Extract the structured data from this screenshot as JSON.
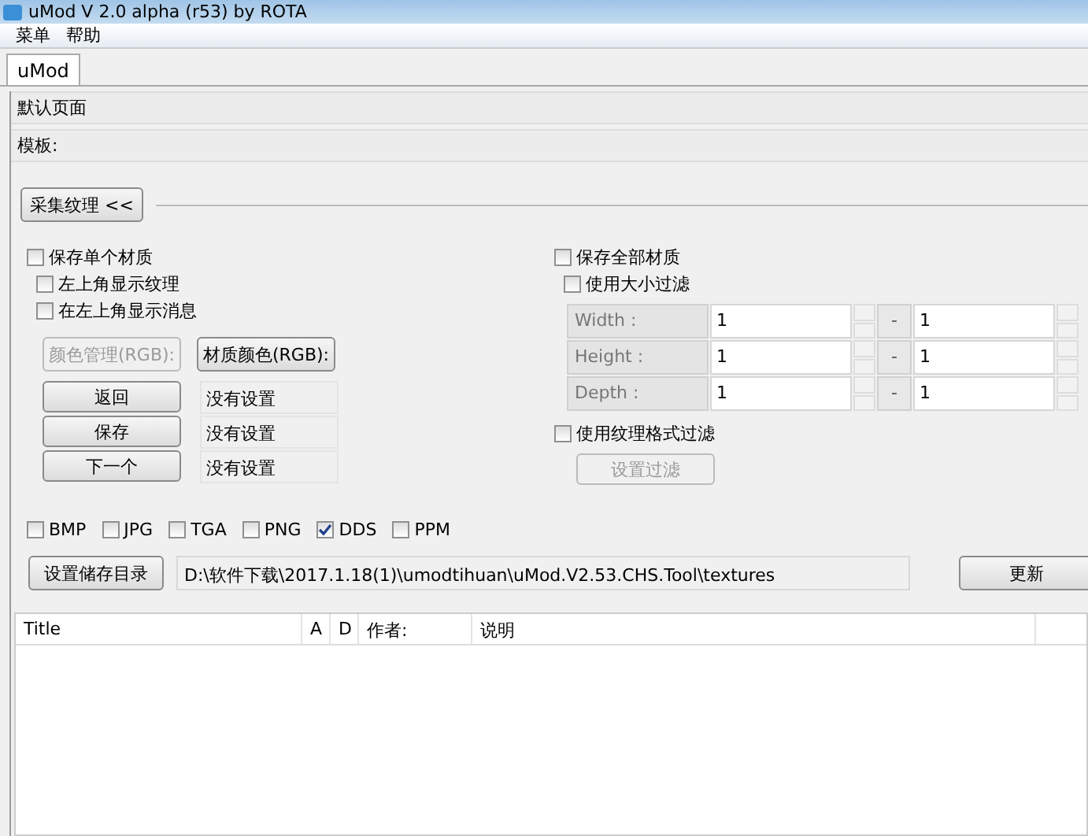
{
  "window": {
    "title": "uMod V 2.0 alpha (r53)  by  ROTA"
  },
  "menu": [
    "菜单",
    "帮助"
  ],
  "tabs": [
    {
      "label": "uMod",
      "selected": true
    }
  ],
  "page_label": "默认页面",
  "template_label": "模板:",
  "collapse_button": "采集纹理 <<",
  "left": {
    "save_single": {
      "label": "保存单个材质",
      "checked": false
    },
    "options": [
      {
        "label": "左上角显示纹理",
        "checked": false
      },
      {
        "label": "在左上角显示消息",
        "checked": false
      }
    ],
    "color_buttons": [
      {
        "label": "颜色管理(RGB):",
        "disabled": true
      },
      {
        "label": "材质颜色(RGB):",
        "disabled": false
      }
    ],
    "actions": [
      {
        "button": "返回",
        "value": "没有设置"
      },
      {
        "button": "保存",
        "value": "没有设置"
      },
      {
        "button": "下一个",
        "value": "没有设置"
      }
    ]
  },
  "right": {
    "save_all": {
      "label": "保存全部材质",
      "checked": false
    },
    "size_filter": {
      "label": "使用大小过滤",
      "checked": false
    },
    "size_rows": [
      {
        "label": "Width :",
        "min": "1",
        "separator": "-",
        "max": "1"
      },
      {
        "label": "Height :",
        "min": "1",
        "separator": "-",
        "max": "1"
      },
      {
        "label": "Depth :",
        "min": "1",
        "separator": "-",
        "max": "1"
      }
    ],
    "format_filter": {
      "label": "使用纹理格式过滤",
      "checked": false
    },
    "set_filter_button": {
      "label": "设置过滤",
      "disabled": true
    }
  },
  "formats": [
    {
      "label": "BMP",
      "checked": false
    },
    {
      "label": "JPG",
      "checked": false
    },
    {
      "label": "TGA",
      "checked": false
    },
    {
      "label": "PNG",
      "checked": false
    },
    {
      "label": "DDS",
      "checked": true
    },
    {
      "label": "PPM",
      "checked": false
    }
  ],
  "output": {
    "button": "设置储存目录",
    "path": "D:\\软件下载\\2017.1.18(1)\\umodtihuan\\uMod.V2.53.CHS.Tool\\textures"
  },
  "refresh_button": "更新",
  "table": {
    "columns": [
      "Title",
      "A",
      "D",
      "作者:",
      "说明"
    ]
  }
}
